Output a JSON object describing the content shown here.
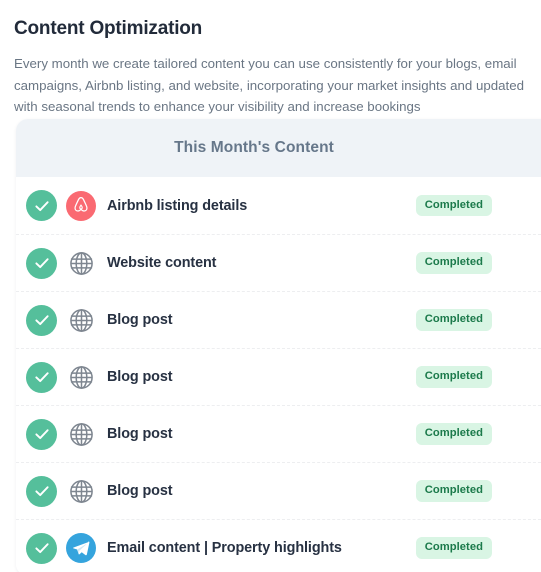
{
  "intro": {
    "title": "Content Optimization",
    "description": "Every month we create tailored content you can use consistently for your blogs, email campaigns, Airbnb listing, and website, incorporating your market insights and updated with seasonal trends to enhance your visibility and increase bookings"
  },
  "card": {
    "header_title": "This Month's Content",
    "rows": [
      {
        "label": "Airbnb listing details",
        "icon": "airbnb-icon",
        "status": "Completed",
        "check": "check-circle-icon"
      },
      {
        "label": "Website content",
        "icon": "globe-icon",
        "status": "Completed",
        "check": "check-circle-icon"
      },
      {
        "label": "Blog post",
        "icon": "globe-icon",
        "status": "Completed",
        "check": "check-circle-icon"
      },
      {
        "label": "Blog post",
        "icon": "globe-icon",
        "status": "Completed",
        "check": "check-circle-icon"
      },
      {
        "label": "Blog post",
        "icon": "globe-icon",
        "status": "Completed",
        "check": "check-circle-icon"
      },
      {
        "label": "Blog post",
        "icon": "globe-icon",
        "status": "Completed",
        "check": "check-circle-icon"
      },
      {
        "label": "Email content | Property highlights",
        "icon": "telegram-icon",
        "status": "Completed",
        "check": "check-circle-icon"
      }
    ]
  },
  "colors": {
    "title_text": "#222b3a",
    "body_text": "#6a7684",
    "card_header_bg": "#eff3f7",
    "card_header_text": "#66778a",
    "row_label_text": "#273142",
    "check_circle": "#55bf9b",
    "badge_bg": "#d9f5e4",
    "badge_text": "#1c7a4b",
    "airbnb_red": "#fa6a72",
    "telegram_blue": "#35a4dd",
    "globe_gray": "#7e8690",
    "row_divider": "#edeef0"
  }
}
